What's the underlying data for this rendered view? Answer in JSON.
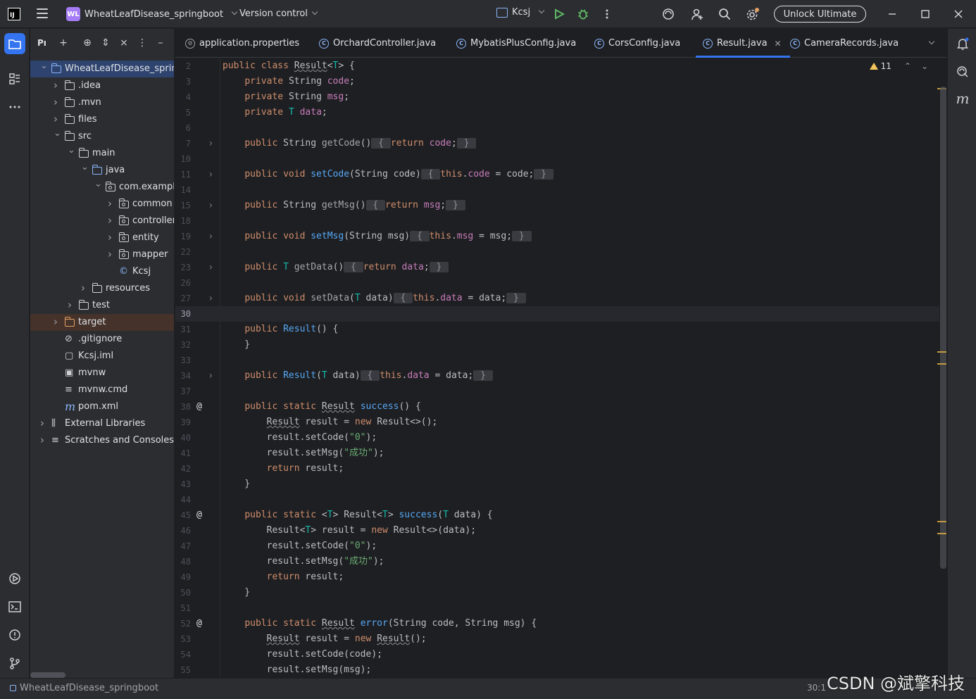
{
  "titlebar": {
    "project_badge": "WL",
    "project_name": "WheatLeafDisease_springboot",
    "version_control": "Version control",
    "run_config": "Kcsj",
    "unlock_label": "Unlock Ultimate"
  },
  "project_panel": {
    "title": "Pı",
    "tree": [
      {
        "label": "WheatLeafDisease_springb",
        "depth": 0,
        "expanded": true,
        "kind": "module",
        "selected": true
      },
      {
        "label": ".idea",
        "depth": 1,
        "expanded": false,
        "kind": "folder"
      },
      {
        "label": ".mvn",
        "depth": 1,
        "expanded": false,
        "kind": "folder"
      },
      {
        "label": "files",
        "depth": 1,
        "expanded": false,
        "kind": "folder"
      },
      {
        "label": "src",
        "depth": 1,
        "expanded": true,
        "kind": "folder"
      },
      {
        "label": "main",
        "depth": 2,
        "expanded": true,
        "kind": "folder"
      },
      {
        "label": "java",
        "depth": 3,
        "expanded": true,
        "kind": "folder-blue"
      },
      {
        "label": "com.example",
        "depth": 4,
        "expanded": true,
        "kind": "package"
      },
      {
        "label": "common",
        "depth": 5,
        "expanded": false,
        "kind": "package"
      },
      {
        "label": "controller",
        "depth": 5,
        "expanded": false,
        "kind": "package"
      },
      {
        "label": "entity",
        "depth": 5,
        "expanded": false,
        "kind": "package"
      },
      {
        "label": "mapper",
        "depth": 5,
        "expanded": false,
        "kind": "package"
      },
      {
        "label": "Kcsj",
        "depth": 5,
        "expanded": null,
        "kind": "class"
      },
      {
        "label": "resources",
        "depth": 3,
        "expanded": false,
        "kind": "folder"
      },
      {
        "label": "test",
        "depth": 2,
        "expanded": false,
        "kind": "folder"
      },
      {
        "label": "target",
        "depth": 1,
        "expanded": false,
        "kind": "folder-orange",
        "highlighted": true
      },
      {
        "label": ".gitignore",
        "depth": 1,
        "expanded": null,
        "kind": "ignore"
      },
      {
        "label": "Kcsj.iml",
        "depth": 1,
        "expanded": null,
        "kind": "iml"
      },
      {
        "label": "mvnw",
        "depth": 1,
        "expanded": null,
        "kind": "script"
      },
      {
        "label": "mvnw.cmd",
        "depth": 1,
        "expanded": null,
        "kind": "text"
      },
      {
        "label": "pom.xml",
        "depth": 1,
        "expanded": null,
        "kind": "maven"
      },
      {
        "label": "External Libraries",
        "depth": 0,
        "expanded": false,
        "kind": "libraries"
      },
      {
        "label": "Scratches and Consoles",
        "depth": 0,
        "expanded": false,
        "kind": "scratches"
      }
    ]
  },
  "tabs": [
    {
      "label": "application.properties",
      "icon": "gear-icon",
      "active": false
    },
    {
      "label": "OrchardController.java",
      "icon": "class-icon",
      "active": false
    },
    {
      "label": "MybatisPlusConfig.java",
      "icon": "class-icon",
      "active": false
    },
    {
      "label": "CorsConfig.java",
      "icon": "class-icon",
      "active": false
    },
    {
      "label": "Result.java",
      "icon": "class-icon",
      "active": true
    },
    {
      "label": "CameraRecords.java",
      "icon": "class-icon",
      "active": false
    }
  ],
  "editor": {
    "warning_count": "11",
    "current_line": "30",
    "lines": [
      {
        "n": "2",
        "html": "<span class='kw'>public class </span><span class='uline'>Result</span>&lt;<span class='tp'>T</span>&gt; {"
      },
      {
        "n": "3",
        "html": "    <span class='kw'>private </span>String <span class='fld'>code</span>;"
      },
      {
        "n": "4",
        "html": "    <span class='kw'>private </span>String <span class='fld'>msg</span>;"
      },
      {
        "n": "5",
        "html": "    <span class='kw'>private </span><span class='tp'>T</span> <span class='fld'>data</span>;"
      },
      {
        "n": "6",
        "html": ""
      },
      {
        "n": "7",
        "fold": true,
        "html": "    <span class='kw'>public </span>String <span class='gr'>getCode</span>()<span class='cbr'> { </span><span class='kw'>return </span><span class='fld'>code</span>;<span class='cbr'> } </span>"
      },
      {
        "n": "10",
        "html": ""
      },
      {
        "n": "11",
        "fold": true,
        "html": "    <span class='kw'>public void </span><span class='fn'>setCode</span>(String code)<span class='cbr'> { </span><span class='kw'>this</span>.<span class='fld'>code</span> = code;<span class='cbr'> } </span>"
      },
      {
        "n": "14",
        "html": ""
      },
      {
        "n": "15",
        "fold": true,
        "html": "    <span class='kw'>public </span>String <span class='gr'>getMsg</span>()<span class='cbr'> { </span><span class='kw'>return </span><span class='fld'>msg</span>;<span class='cbr'> } </span>"
      },
      {
        "n": "18",
        "html": ""
      },
      {
        "n": "19",
        "fold": true,
        "html": "    <span class='kw'>public void </span><span class='fn'>setMsg</span>(String msg)<span class='cbr'> { </span><span class='kw'>this</span>.<span class='fld'>msg</span> = msg;<span class='cbr'> } </span>"
      },
      {
        "n": "22",
        "html": ""
      },
      {
        "n": "23",
        "fold": true,
        "html": "    <span class='kw'>public </span><span class='tp'>T</span> <span class='gr'>getData</span>()<span class='cbr'> { </span><span class='kw'>return </span><span class='fld'>data</span>;<span class='cbr'> } </span>"
      },
      {
        "n": "26",
        "html": ""
      },
      {
        "n": "27",
        "fold": true,
        "html": "    <span class='kw'>public void </span><span class='gr'>setData</span>(<span class='tp'>T</span> data)<span class='cbr'> { </span><span class='kw'>this</span>.<span class='fld'>data</span> = data;<span class='cbr'> } </span>"
      },
      {
        "n": "30",
        "html": "",
        "current": true
      },
      {
        "n": "31",
        "html": "    <span class='kw'>public </span><span class='fn'>Result</span>() {"
      },
      {
        "n": "32",
        "html": "    }"
      },
      {
        "n": "33",
        "html": ""
      },
      {
        "n": "34",
        "fold": true,
        "html": "    <span class='kw'>public </span><span class='fn'>Result</span>(<span class='tp'>T</span> data)<span class='cbr'> { </span><span class='kw'>this</span>.<span class='fld'>data</span> = data;<span class='cbr'> } </span>"
      },
      {
        "n": "37",
        "html": ""
      },
      {
        "n": "38",
        "at": true,
        "html": "    <span class='kw'>public static </span><span class='uline'>Result</span> <span class='fn'>success</span>() {"
      },
      {
        "n": "39",
        "html": "        <span class='uline'>Result</span> result = <span class='kw'>new </span>Result&lt;&gt;();"
      },
      {
        "n": "40",
        "html": "        result.setCode(<span class='str'>\"0\"</span>);"
      },
      {
        "n": "41",
        "html": "        result.setMsg(<span class='str'>\"成功\"</span>);"
      },
      {
        "n": "42",
        "html": "        <span class='kw'>return </span>result;"
      },
      {
        "n": "43",
        "html": "    }"
      },
      {
        "n": "44",
        "html": ""
      },
      {
        "n": "45",
        "at": true,
        "html": "    <span class='kw'>public static </span>&lt;<span class='tp'>T</span>&gt; Result&lt;<span class='tp'>T</span>&gt; <span class='fn'>success</span>(<span class='tp'>T</span> data) {"
      },
      {
        "n": "46",
        "html": "        Result&lt;<span class='tp'>T</span>&gt; result = <span class='kw'>new </span>Result&lt;&gt;(data);"
      },
      {
        "n": "47",
        "html": "        result.setCode(<span class='str'>\"0\"</span>);"
      },
      {
        "n": "48",
        "html": "        result.setMsg(<span class='str'>\"成功\"</span>);"
      },
      {
        "n": "49",
        "html": "        <span class='kw'>return </span>result;"
      },
      {
        "n": "50",
        "html": "    }"
      },
      {
        "n": "51",
        "html": ""
      },
      {
        "n": "52",
        "at": true,
        "html": "    <span class='kw'>public static </span><span class='uline'>Result</span> <span class='fn'>error</span>(String code, String msg) {"
      },
      {
        "n": "53",
        "html": "        <span class='uline'>Result</span> result = <span class='kw'>new </span><span class='uline'>Result</span>();"
      },
      {
        "n": "54",
        "html": "        result.setCode(code);"
      },
      {
        "n": "55",
        "html": "        result.setMsg(msg);"
      }
    ]
  },
  "statusbar": {
    "project": "WheatLeafDisease_springboot",
    "position": "30:1"
  },
  "watermark": "CSDN @斌擎科技",
  "colors": {
    "accent": "#3574f0",
    "keyword": "#cf8e6d",
    "function": "#56a8f5",
    "field": "#c77dbb",
    "type_param": "#16baac",
    "string": "#6aab73",
    "warning": "#f2c55c"
  }
}
